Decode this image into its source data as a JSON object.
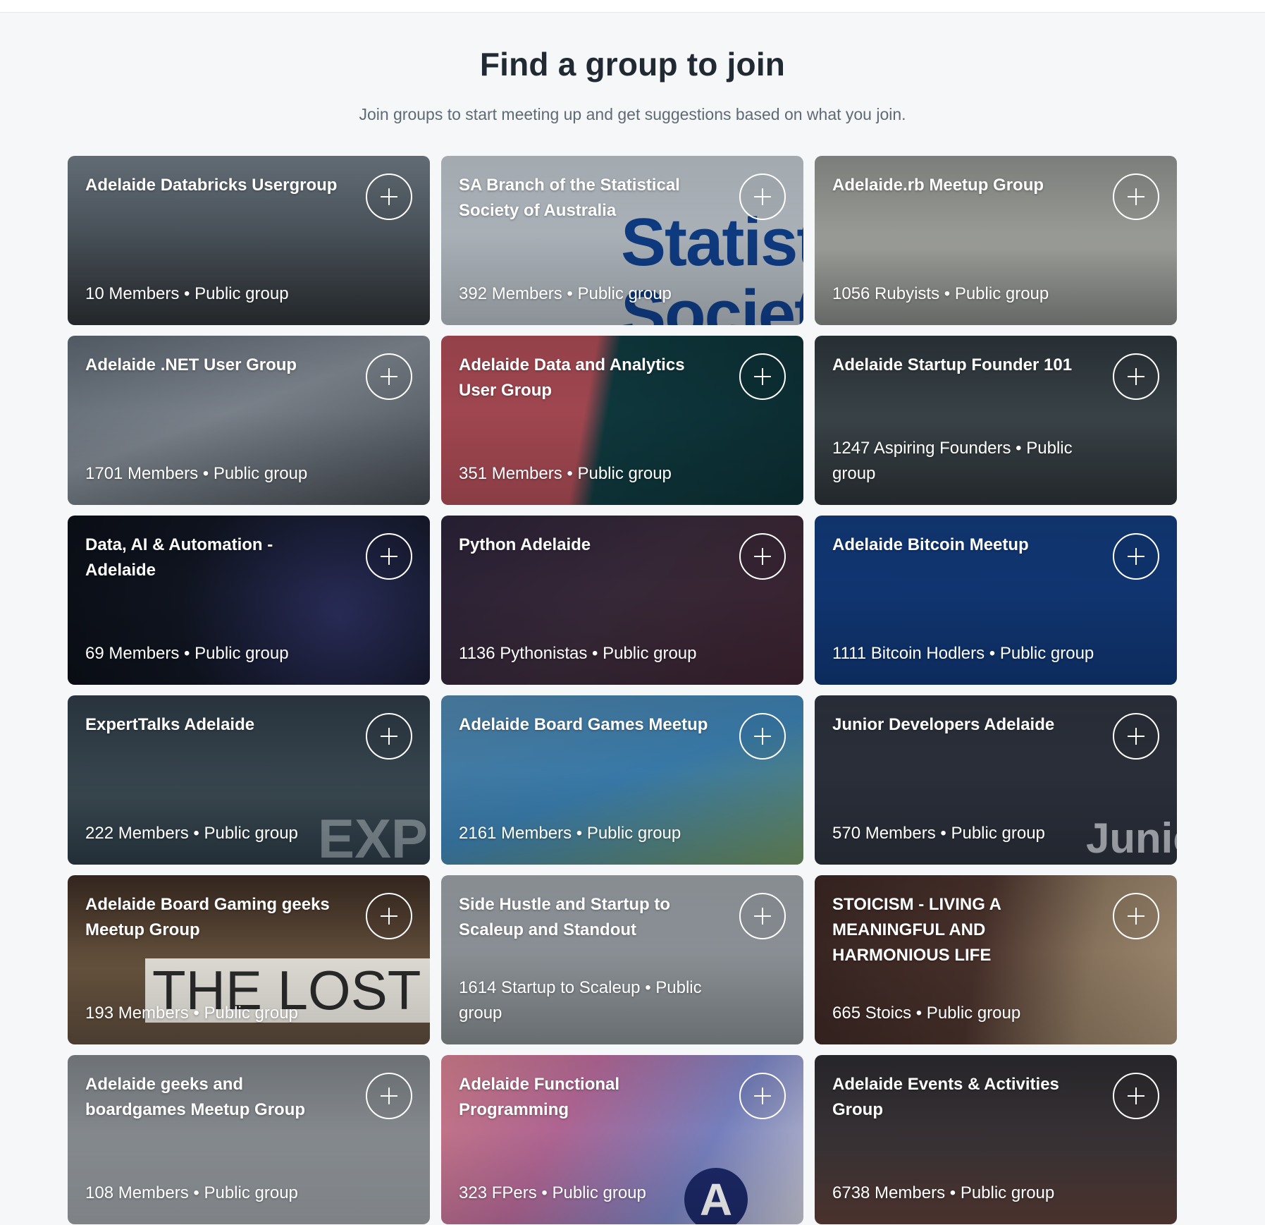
{
  "header": {
    "title": "Find a group to join",
    "subtitle": "Join groups to start meeting up and get suggestions based on what you join."
  },
  "groups": [
    {
      "title": "Adelaide Databricks Usergroup",
      "meta": "10 Members • Public group",
      "bg": "linear-gradient(180deg,#6f7a84 0%,#4c555d 45%,#2b2f33 100%)",
      "icon": "plus-icon"
    },
    {
      "title": "SA Branch of the Statistical Society of Australia",
      "meta": "392 Members • Public group",
      "bg": "linear-gradient(180deg,#b9c1c8 0%,#a9b1b8 100%)",
      "icon": "plus-icon"
    },
    {
      "title": "Adelaide.rb Meetup Group",
      "meta": "1056 Rubyists • Public group",
      "bg": "linear-gradient(180deg,#8c8f8b 0%,#a3a5a0 55%,#7b7f7c 100%)",
      "icon": "plus-icon"
    },
    {
      "title": "Adelaide .NET User Group",
      "meta": "1701 Members • Public group",
      "bg": "linear-gradient(160deg,#5b6470 0%,#7f8790 45%,#3f454c 100%)",
      "icon": "plus-icon"
    },
    {
      "title": "Adelaide Data and Analytics User Group",
      "meta": "351 Members • Public group",
      "bg": "linear-gradient(100deg,#a84a54 0%,#a84a54 40%,#0f3a3f 46%,#0c2f34 100%)",
      "icon": "plus-icon"
    },
    {
      "title": "Adelaide Startup Founder 101",
      "meta": "1247 Aspiring Founders • Public group",
      "bg": "linear-gradient(180deg,#2c353b 0%,#3c464b 50%,#2a3035 100%)",
      "icon": "plus-icon"
    },
    {
      "title": "Data, AI & Automation - Adelaide",
      "meta": "69 Members • Public group",
      "bg": "radial-gradient(circle at 75% 60%, #2b2e5c 0%, #101521 55%, #0b0f17 100%)",
      "icon": "plus-icon"
    },
    {
      "title": "Python Adelaide",
      "meta": "1136 Pythonistas • Public group",
      "bg": "linear-gradient(135deg,#2a2238 0%,#3a2a3a 50%,#3c2230 100%)",
      "icon": "plus-icon"
    },
    {
      "title": "Adelaide Bitcoin Meetup",
      "meta": "1111 Bitcoin Hodlers • Public group",
      "bg": "linear-gradient(180deg,#123a7a 0%,#0f3470 100%)",
      "icon": "plus-icon"
    },
    {
      "title": "ExpertTalks Adelaide",
      "meta": "222 Members • Public group",
      "bg": "linear-gradient(180deg,#2d3a45 0%,#3b4a53 60%,#2a3944 100%)",
      "icon": "plus-icon"
    },
    {
      "title": "Adelaide Board Games Meetup",
      "meta": "2161 Members • Public group",
      "bg": "linear-gradient(160deg,#4f83a8 0%,#3b7fb0 50%,#6b8d5c 100%)",
      "icon": "plus-icon"
    },
    {
      "title": "Junior Developers Adelaide",
      "meta": "570 Members • Public group",
      "bg": "linear-gradient(180deg,#2d323d 0%,#2a2f3a 100%)",
      "icon": "plus-icon"
    },
    {
      "title": "Adelaide Board Gaming geeks Meetup Group",
      "meta": "193 Members • Public group",
      "bg": "linear-gradient(180deg,#3a2a22 0%,#6b5640 55%,#5a4a3b 100%)",
      "icon": "plus-icon"
    },
    {
      "title": "Side Hustle and Startup to Scaleup and Standout",
      "meta": "1614 Startup to Scaleup • Public group",
      "bg": "linear-gradient(180deg,#9aa0a6 0%,#8d9398 60%,#7f8589 100%)",
      "icon": "plus-icon"
    },
    {
      "title": "STOICISM - LIVING A MEANINGFUL AND HARMONIOUS LIFE",
      "meta": "665 Stoics • Public group",
      "bg": "linear-gradient(100deg,#3a2623 0%,#4a322c 45%,#8f7a62 75%,#a38d74 100%)",
      "icon": "plus-icon"
    },
    {
      "title": "Adelaide geeks and boardgames Meetup Group",
      "meta": "108 Members • Public group",
      "bg": "linear-gradient(180deg,#7c8186 0%,#8f9499 60%,#9a9fa3 100%)",
      "icon": "plus-icon"
    },
    {
      "title": "Adelaide Functional Programming",
      "meta": "323 FPers • Public group",
      "bg": "linear-gradient(120deg,#d17e8c 0%,#b76a9a 35%,#7c86c6 70%,#c9c9d6 100%)",
      "icon": "plus-icon"
    },
    {
      "title": "Adelaide Events & Activities Group",
      "meta": "6738 Members • Public group",
      "bg": "linear-gradient(180deg,#2b2a2f 0%,#3c3538 55%,#5a3c36 100%)",
      "icon": "plus-icon"
    }
  ],
  "decor": {
    "stat_text": "Statist",
    "soc_text": "Societ",
    "expert_text": "EXPE",
    "junior_text": "Junic",
    "dice_text": "THE LOST DICE",
    "fp_letter": "A"
  }
}
